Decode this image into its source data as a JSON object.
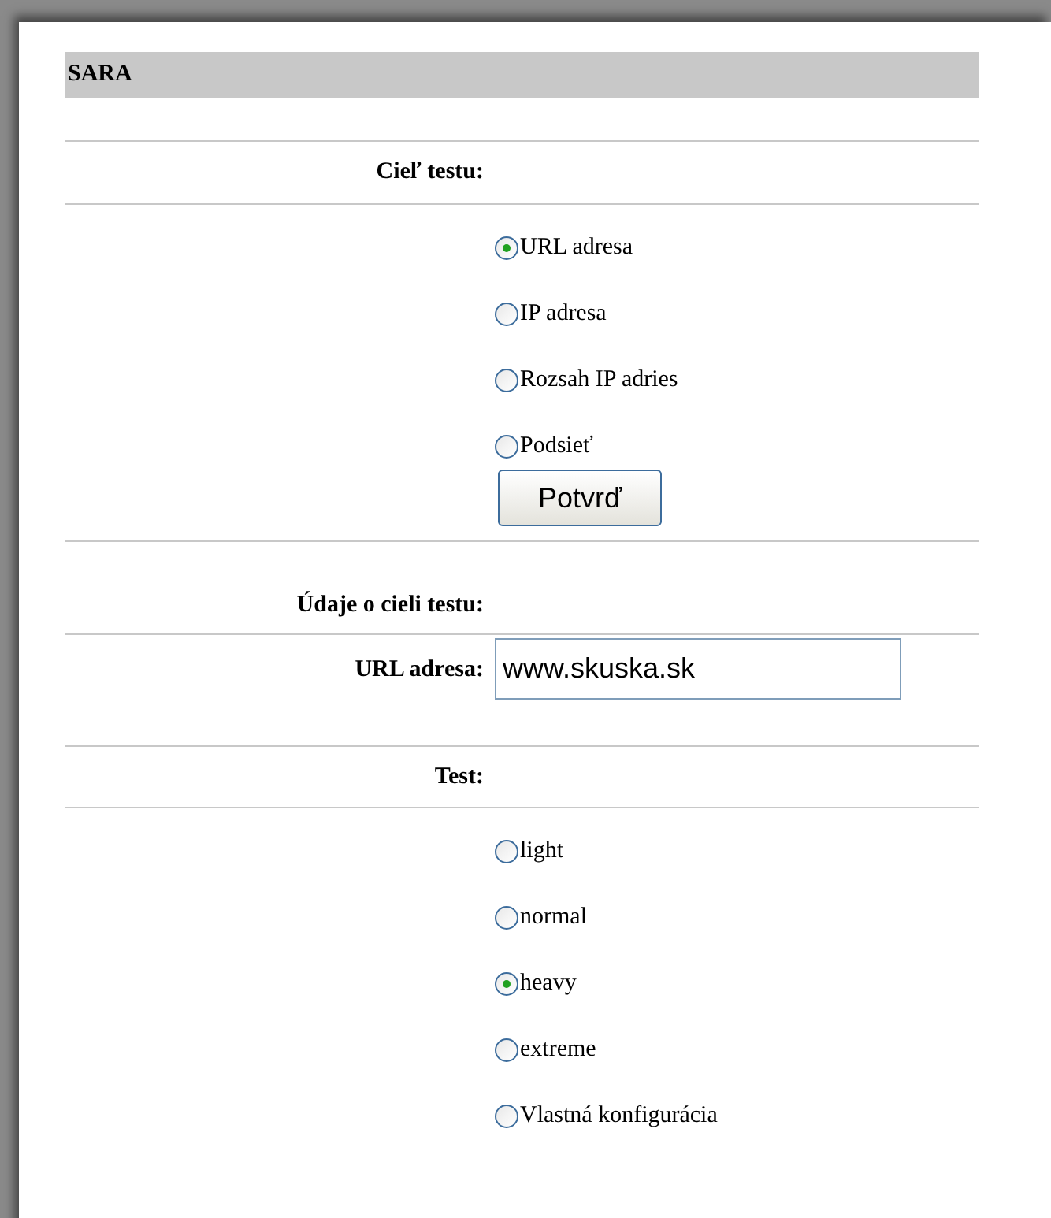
{
  "title": "SARA",
  "target_section": {
    "label": "Cieľ testu:",
    "options": [
      {
        "label": "URL adresa",
        "selected": true
      },
      {
        "label": "IP adresa",
        "selected": false
      },
      {
        "label": "Rozsah IP adries",
        "selected": false
      },
      {
        "label": "Podsieť",
        "selected": false
      }
    ],
    "button": "Potvrď"
  },
  "details_section": {
    "label": "Údaje o cieli testu:",
    "field_label": "URL adresa:",
    "field_value": "www.skuska.sk"
  },
  "test_section": {
    "label": "Test:",
    "options": [
      {
        "label": "light",
        "selected": false
      },
      {
        "label": "normal",
        "selected": false
      },
      {
        "label": "heavy",
        "selected": true
      },
      {
        "label": "extreme",
        "selected": false
      },
      {
        "label": "Vlastná konfigurácia",
        "selected": false
      }
    ]
  }
}
